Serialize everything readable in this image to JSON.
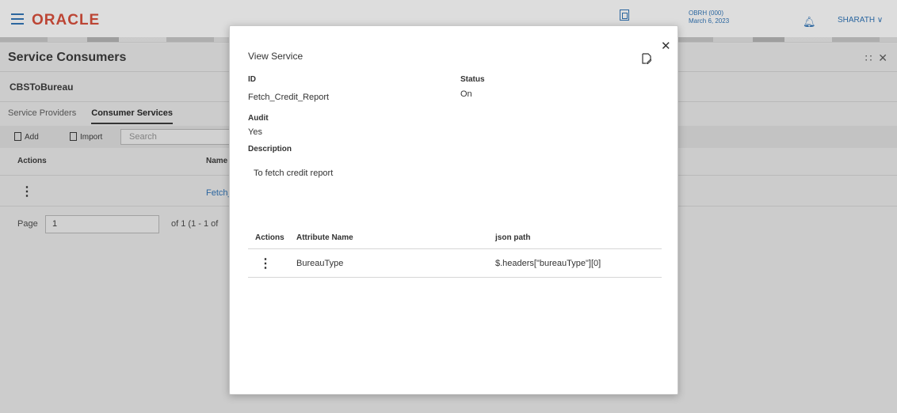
{
  "header": {
    "logo": "ORACLE",
    "branch_code": "OBRH (000)",
    "branch_date": "March 6, 2023",
    "user": "SHARATH"
  },
  "page": {
    "title": "Service Consumers",
    "consumer_name": "CBSToBureau",
    "tabs": [
      "Service Providers",
      "Consumer Services"
    ],
    "toolbar": {
      "add_label": "Add",
      "import_label": "Import",
      "search_placeholder": "Search"
    },
    "grid": {
      "headers": [
        "Actions",
        "Name"
      ],
      "row_name": "Fetch_"
    },
    "pager": {
      "page_label": "Page",
      "page_value": "1",
      "of_text": "of 1  (1 - 1 of"
    }
  },
  "modal": {
    "title": "View Service",
    "id_label": "ID",
    "id_value": "Fetch_Credit_Report",
    "status_label": "Status",
    "status_value": "On",
    "audit_label": "Audit",
    "audit_value": "Yes",
    "description_label": "Description",
    "description_value": "To fetch credit report",
    "table": {
      "headers": [
        "Actions",
        "Attribute Name",
        "json path"
      ],
      "rows": [
        {
          "attribute": "BureauType",
          "json_path": "$.headers[\"bureauType\"][0]"
        }
      ]
    }
  }
}
